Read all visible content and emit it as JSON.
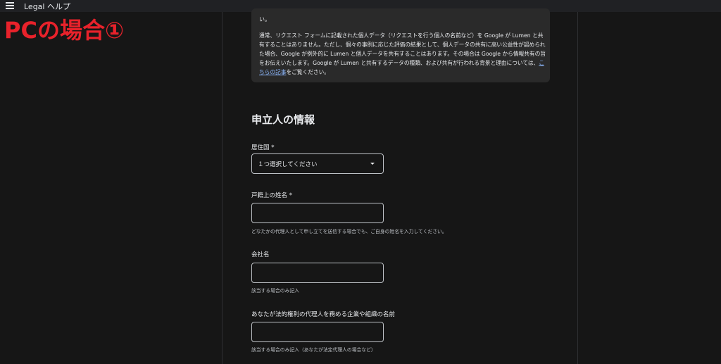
{
  "topbar": {
    "app_title": "Legal ヘルプ",
    "menu_icon": "menu-icon"
  },
  "overlay": {
    "label": "PCの場合①",
    "color": "#e8222b"
  },
  "notice": {
    "top_fragment": "い。",
    "text_main": "通常、リクエスト フォームに記載された個人データ（リクエストを行う個人の名前など）を Google が Lumen と共有することはありません。ただし、個々の事例に応じた評価の結果として、個人データの共有に高い公益性が認められた場合、Google が例外的に Lumen と個人データを共有することはあります。その場合は Google から情報共有の旨をお伝えいたします。Google が Lumen と共有するデータの種類、および共有が行われる背景と理由については、",
    "link_text": "こちらの記事",
    "text_after_link": "をご覧ください。"
  },
  "form": {
    "section_title": "申立人の情報",
    "country": {
      "label": "居住国 *",
      "selected": "１つ選択してください"
    },
    "legal_name": {
      "label": "戸籍上の姓名 *",
      "value": "",
      "helper": "どなたかの代理人として申し立てを送信する場合でも、ご自身の姓名を入力してください。"
    },
    "company": {
      "label": "会社名",
      "value": "",
      "helper": "該当する場合のみ記入"
    },
    "represented": {
      "label": "あなたが法的権利の代理人を務める企業や組織の名前",
      "value": "",
      "helper": "該当する場合のみ記入（あなたが法定代理人の場合など）"
    }
  },
  "colors": {
    "background": "#161616",
    "panel": "#2a2a2a",
    "link": "#8ab4f8",
    "text": "#e8eaed"
  }
}
